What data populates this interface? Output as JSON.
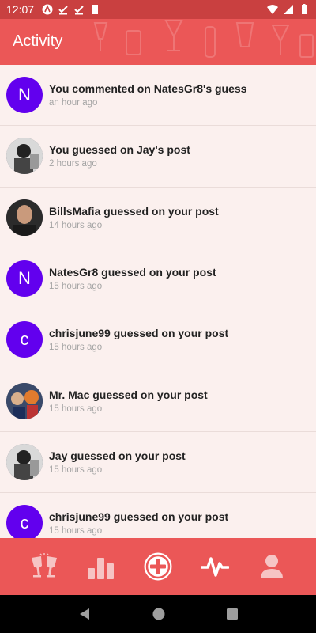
{
  "status": {
    "time": "12:07"
  },
  "header": {
    "title": "Activity"
  },
  "activities": [
    {
      "avatar_type": "letter",
      "initial": "N",
      "text": "You commented on NatesGr8's guess",
      "time": "an hour ago"
    },
    {
      "avatar_type": "photo",
      "initial": "",
      "text": "You guessed on Jay's post",
      "time": "2 hours ago"
    },
    {
      "avatar_type": "photo",
      "initial": "",
      "text": "BillsMafia guessed on your post",
      "time": "14 hours ago"
    },
    {
      "avatar_type": "letter",
      "initial": "N",
      "text": "NatesGr8 guessed on your post",
      "time": "15 hours ago"
    },
    {
      "avatar_type": "letter",
      "initial": "c",
      "text": "chrisjune99 guessed on your post",
      "time": "15 hours ago"
    },
    {
      "avatar_type": "photo",
      "initial": "",
      "text": "Mr. Mac  guessed on your post",
      "time": "15 hours ago"
    },
    {
      "avatar_type": "photo",
      "initial": "",
      "text": "Jay guessed on your post",
      "time": "15 hours ago"
    },
    {
      "avatar_type": "letter",
      "initial": "c",
      "text": "chrisjune99 guessed on your post",
      "time": "15 hours ago"
    }
  ],
  "bottom_nav": [
    {
      "icon": "cheers-icon"
    },
    {
      "icon": "bar-chart-icon"
    },
    {
      "icon": "add-circle-icon"
    },
    {
      "icon": "activity-pulse-icon"
    },
    {
      "icon": "profile-icon"
    }
  ],
  "colors": {
    "primary": "#eb5757",
    "status": "#c94040",
    "avatar": "#6200ee",
    "background": "#fbf0ee"
  }
}
